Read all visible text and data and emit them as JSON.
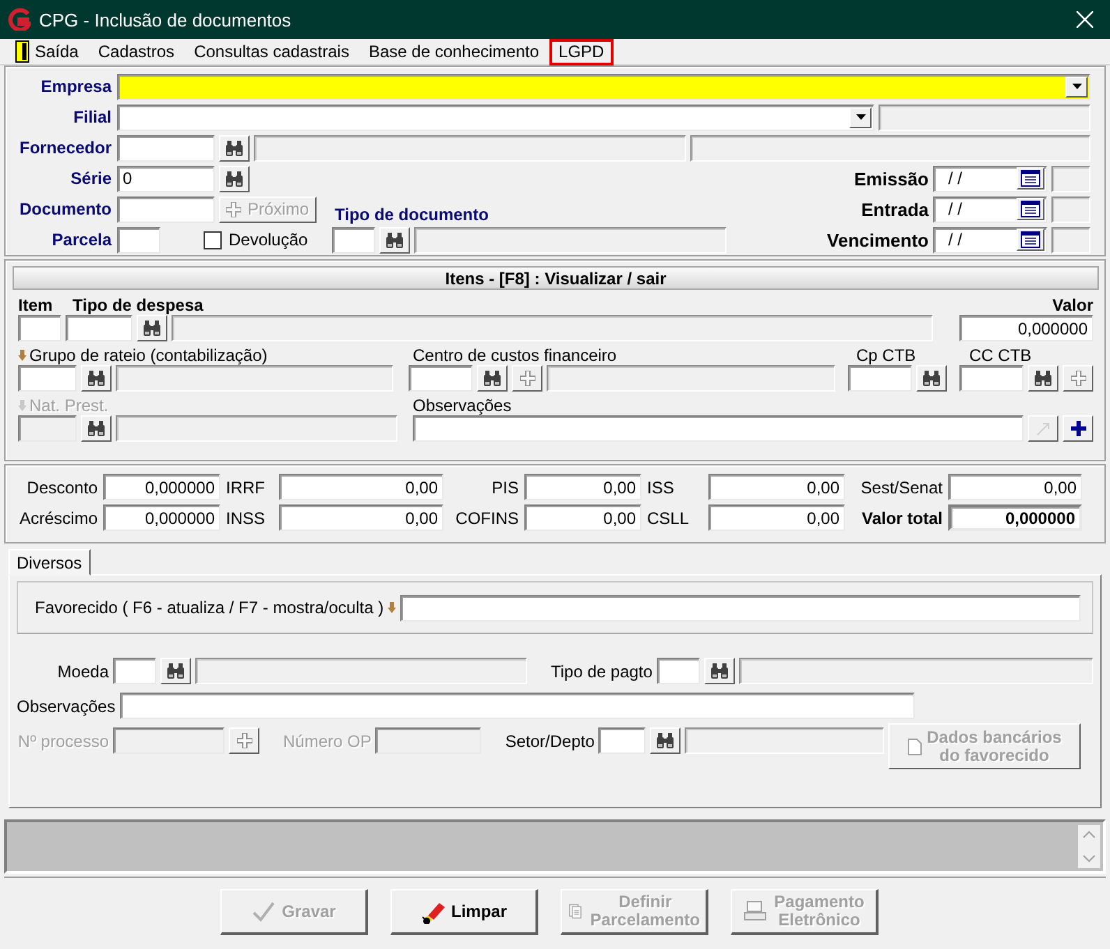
{
  "window": {
    "title": "CPG - Inclusão de documentos"
  },
  "menu": [
    {
      "label": "Saída",
      "kind": "exit",
      "highlighted": false
    },
    {
      "label": "Cadastros",
      "kind": "plain",
      "highlighted": false
    },
    {
      "label": "Consultas cadastrais",
      "kind": "plain",
      "highlighted": false
    },
    {
      "label": "Base de conhecimento",
      "kind": "plain",
      "highlighted": false
    },
    {
      "label": "LGPD",
      "kind": "plain",
      "highlighted": true
    }
  ],
  "header": {
    "empresa_label": "Empresa",
    "filial_label": "Filial",
    "fornecedor_label": "Fornecedor",
    "serie_label": "Série",
    "serie_value": "0",
    "documento_label": "Documento",
    "proximo_button": {
      "label": "Próximo",
      "disabled": true
    },
    "parcela_label": "Parcela",
    "devolucao": {
      "label": "Devolução",
      "checked": false
    },
    "tipo_documento_label": "Tipo de documento",
    "dates": [
      {
        "label": "Emissão",
        "value": "/ /"
      },
      {
        "label": "Entrada",
        "value": "/ /"
      },
      {
        "label": "Vencimento",
        "value": "/ /"
      }
    ]
  },
  "items": {
    "title": "Itens  - [F8] : Visualizar / sair",
    "item_label": "Item",
    "tipo_despesa_label": "Tipo de despesa",
    "valor_label": "Valor",
    "valor_value": "0,000000",
    "grupo_rateio": {
      "label": "Grupo de rateio (contabilização)",
      "disabled": false
    },
    "centro_custos_label": "Centro de custos financeiro",
    "cp_ctb_label": "Cp CTB",
    "cc_ctb_label": "CC CTB",
    "nat_prest": {
      "label": "Nat. Prest.",
      "disabled": true
    },
    "observacoes_label": "Observações"
  },
  "totals": [
    {
      "label": "Desconto",
      "value": "0,000000",
      "emphasis": false
    },
    {
      "label": "IRRF",
      "value": "0,00",
      "emphasis": false
    },
    {
      "label": "PIS",
      "value": "0,00",
      "emphasis": false
    },
    {
      "label": "ISS",
      "value": "0,00",
      "emphasis": false
    },
    {
      "label": "Sest/Senat",
      "value": "0,00",
      "emphasis": false
    },
    {
      "label": "Acréscimo",
      "value": "0,000000",
      "emphasis": false
    },
    {
      "label": "INSS",
      "value": "0,00",
      "emphasis": false
    },
    {
      "label": "COFINS",
      "value": "0,00",
      "emphasis": false
    },
    {
      "label": "CSLL",
      "value": "0,00",
      "emphasis": false
    },
    {
      "label": "Valor total",
      "value": "0,000000",
      "emphasis": true
    }
  ],
  "tabs": [
    {
      "label": "Diversos",
      "selected": true
    }
  ],
  "diversos": {
    "favorecido_label": "Favorecido ( F6 - atualiza / F7 - mostra/oculta )",
    "moeda_label": "Moeda",
    "tipo_pagto_label": "Tipo de pagto",
    "observacoes_label": "Observações",
    "processo": {
      "label": "Nº processo",
      "disabled": true
    },
    "numero_op": {
      "label": "Número OP",
      "disabled": true
    },
    "setor_label": "Setor/Depto",
    "dados_bancarios_button": {
      "lines": [
        "Dados bancários",
        "do favorecido"
      ],
      "disabled": true
    }
  },
  "buttons": [
    {
      "lines": [
        "Gravar"
      ],
      "kind": "save",
      "disabled": true
    },
    {
      "lines": [
        "Limpar"
      ],
      "kind": "clear",
      "disabled": false
    },
    {
      "lines": [
        "Definir",
        "Parcelamento"
      ],
      "kind": "installments",
      "disabled": true
    },
    {
      "lines": [
        "Pagamento",
        "Eletrônico"
      ],
      "kind": "payment",
      "disabled": true
    }
  ]
}
